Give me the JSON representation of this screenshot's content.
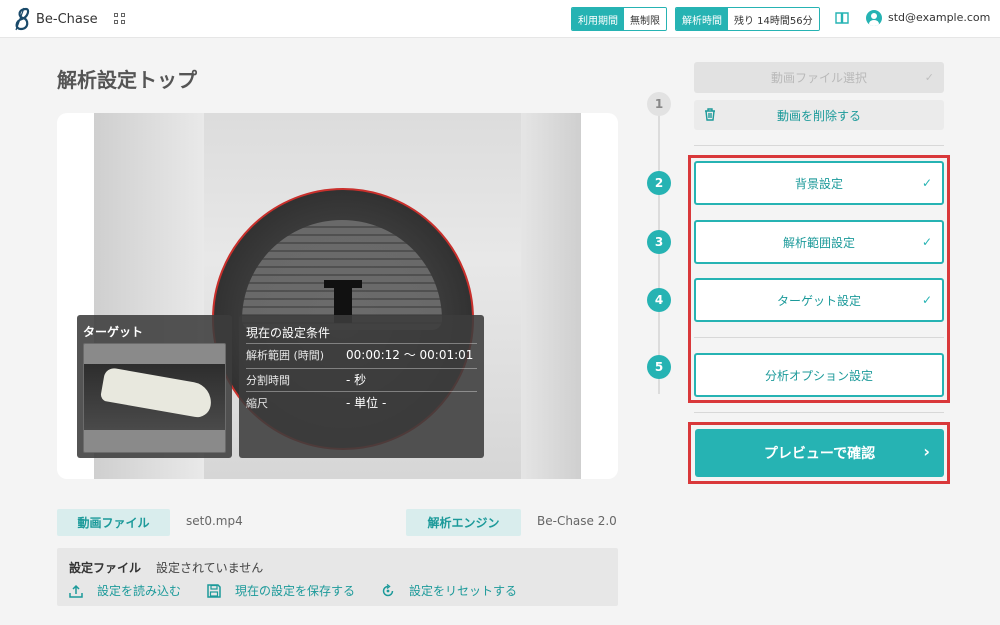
{
  "header": {
    "logo_text": "Be-Chase",
    "usage_period_label": "利用期間",
    "usage_period_value": "無制限",
    "analysis_time_label": "解析時間",
    "analysis_time_value": "残り 14時間56分",
    "user_email": "std@example.com"
  },
  "page": {
    "title": "解析設定トップ"
  },
  "preview": {
    "target_title": "ターゲット",
    "conditions": {
      "title": "現在の設定条件",
      "rows": [
        {
          "label": "解析範囲 (時間)",
          "value": "00:00:12 〜 00:01:01"
        },
        {
          "label": "分割時間",
          "value": "- 秒"
        },
        {
          "label": "縮尺",
          "value": "- 単位 -"
        }
      ]
    }
  },
  "info": {
    "video_file_label": "動画ファイル",
    "video_file_value": "set0.mp4",
    "engine_label": "解析エンジン",
    "engine_value": "Be-Chase 2.0"
  },
  "settings": {
    "title": "設定ファイル",
    "status": "設定されていません",
    "actions": {
      "load": "設定を読み込む",
      "save": "現在の設定を保存する",
      "reset": "設定をリセットする"
    }
  },
  "steps": {
    "step1": {
      "number": "1",
      "label": "動画ファイル選択",
      "check": "✓",
      "delete_label": "動画を削除する"
    },
    "step2": {
      "number": "2",
      "label": "背景設定",
      "check": "✓"
    },
    "step3": {
      "number": "3",
      "label": "解析範囲設定",
      "check": "✓"
    },
    "step4": {
      "number": "4",
      "label": "ターゲット設定",
      "check": "✓"
    },
    "step5": {
      "number": "5",
      "label": "分析オプション設定"
    }
  },
  "preview_button": {
    "label": "プレビューで確認",
    "arrow": "›"
  },
  "colors": {
    "accent": "#26b3b3",
    "highlight": "#d9383a"
  }
}
